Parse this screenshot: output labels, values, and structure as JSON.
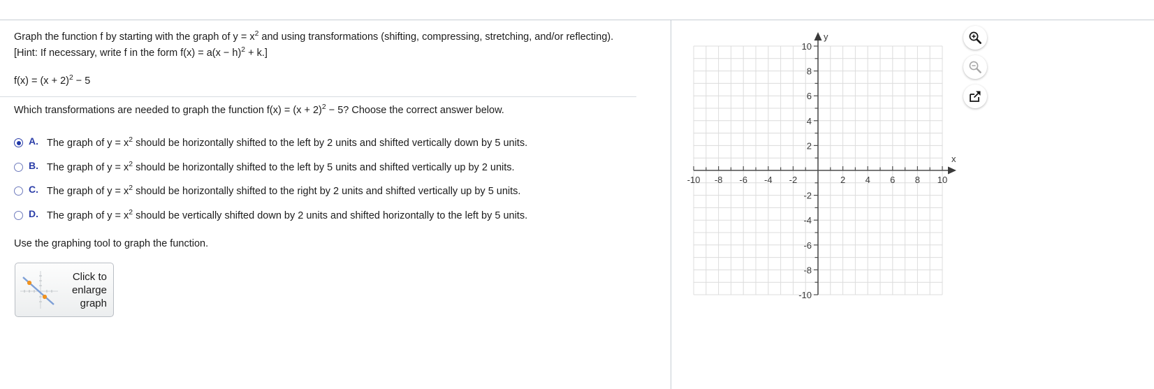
{
  "problem": {
    "instruction_part1": "Graph the function f by starting with the graph of y = x",
    "instruction_exp1": "2",
    "instruction_part2": " and using transformations (shifting, compressing, stretching, and/or reflecting). [Hint: If necessary, write f in the form f(x) = a(x − h)",
    "instruction_exp2": "2",
    "instruction_part3": " + k.]",
    "function_part1": "f(x) = (x + 2)",
    "function_exp": "2",
    "function_part2": " − 5",
    "question_part1": "Which transformations are needed to graph the function f(x) = (x + 2)",
    "question_exp": "2",
    "question_part2": " − 5? Choose the correct answer below.",
    "use_tool_text": "Use the graphing tool to graph the function."
  },
  "choices": [
    {
      "letter": "A.",
      "selected": true,
      "text_part1": "The graph of y = x",
      "exp": "2",
      "text_part2": " should be horizontally shifted to the left by 2 units and shifted vertically down by 5 units."
    },
    {
      "letter": "B.",
      "selected": false,
      "text_part1": "The graph of y = x",
      "exp": "2",
      "text_part2": " should be horizontally shifted to the left by 5 units and shifted vertically up by 2 units."
    },
    {
      "letter": "C.",
      "selected": false,
      "text_part1": "The graph of y = x",
      "exp": "2",
      "text_part2": " should be horizontally shifted to the right by 2 units and shifted vertically up by 5 units."
    },
    {
      "letter": "D.",
      "selected": false,
      "text_part1": "The graph of y = x",
      "exp": "2",
      "text_part2": " should be vertically shifted down by 2 units and shifted horizontally to the left by 5 units."
    }
  ],
  "enlarge_button": {
    "label_line1": "Click to",
    "label_line2": "enlarge",
    "label_line3": "graph",
    "thumbnail_icon": "small-graph-with-line-and-two-points"
  },
  "graph_tools": [
    {
      "name": "zoom-in-icon",
      "label": "Zoom in",
      "enabled": true
    },
    {
      "name": "zoom-out-icon",
      "label": "Zoom out",
      "enabled": false
    },
    {
      "name": "open-in-new-window-icon",
      "label": "Open graph in new window",
      "enabled": true
    }
  ],
  "colors": {
    "accent_blue": "#2b3ea8",
    "radio_blue": "#6f7bbd",
    "rule": "#c7cdd4",
    "grid": "#d8d8d8",
    "axis": "#4d4d4d",
    "text": "#1c1c1c"
  },
  "chart_data": {
    "type": "scatter",
    "title": "",
    "xlabel": "x",
    "ylabel": "y",
    "xlim": [
      -10,
      10
    ],
    "ylim": [
      -10,
      10
    ],
    "x_ticks": [
      -10,
      -8,
      -6,
      -4,
      -2,
      2,
      4,
      6,
      8,
      10
    ],
    "y_ticks": [
      10,
      8,
      6,
      4,
      2,
      -2,
      -4,
      -6,
      -8,
      -10
    ],
    "x_tick_labels": [
      "-10",
      "-8",
      "-6",
      "-4",
      "-2",
      "2",
      "4",
      "6",
      "8",
      "10"
    ],
    "y_tick_labels": [
      "10",
      "8",
      "6",
      "4",
      "2",
      "-2",
      "-4",
      "-6",
      "-8",
      "-10"
    ],
    "minor_grid_step": 1,
    "grid": true,
    "legend": false,
    "series": [],
    "note": "Empty coordinate plane; no curve has been plotted yet."
  }
}
